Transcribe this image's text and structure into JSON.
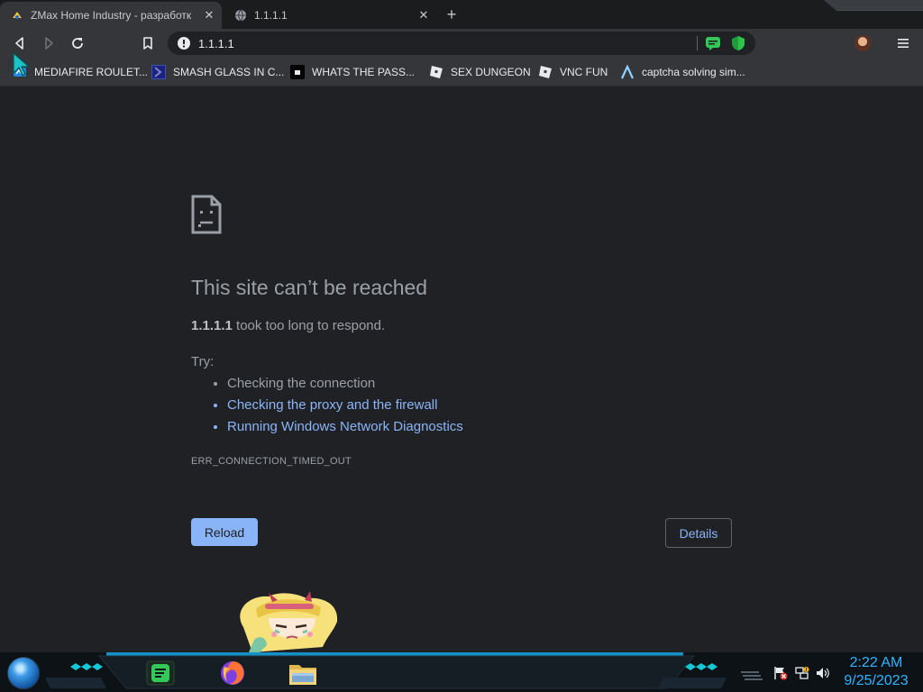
{
  "tabs": [
    {
      "title": "ZMax Home Industry - разработк",
      "active": true,
      "favicon": "zmax-favicon-icon"
    },
    {
      "title": "1.1.1.1",
      "active": false,
      "favicon": "globe-icon"
    }
  ],
  "toolbar": {
    "url": "1.1.1.1",
    "site_info_icon": "not-secure-icon"
  },
  "bookmarks": [
    {
      "label": "MEDIAFIRE ROULET...",
      "icon": "mediafire-icon"
    },
    {
      "label": "SMASH GLASS IN C...",
      "icon": "arrow-bracket-icon"
    },
    {
      "label": "WHATS THE PASS...",
      "icon": "dark-tile-icon"
    },
    {
      "label": "SEX DUNGEON",
      "icon": "roblox-icon"
    },
    {
      "label": "VNC FUN",
      "icon": "roblox-icon"
    },
    {
      "label": "captcha solving sim...",
      "icon": "lambda-icon"
    }
  ],
  "error": {
    "title": "This site can’t be reached",
    "host": "1.1.1.1",
    "description": "took too long to respond.",
    "try_label": "Try:",
    "suggestions": [
      {
        "text": "Checking the connection",
        "link": false
      },
      {
        "text": "Checking the proxy and the firewall",
        "link": true
      },
      {
        "text": "Running Windows Network Diagnostics",
        "link": true
      }
    ],
    "code": "ERR_CONNECTION_TIMED_OUT",
    "reload_label": "Reload",
    "details_label": "Details"
  },
  "taskbar": {
    "clock_time": "2:22 AM",
    "clock_date": "9/25/2023"
  },
  "colors": {
    "page_bg": "#202124",
    "link": "#8ab4f8",
    "clock": "#2fb4ff"
  }
}
